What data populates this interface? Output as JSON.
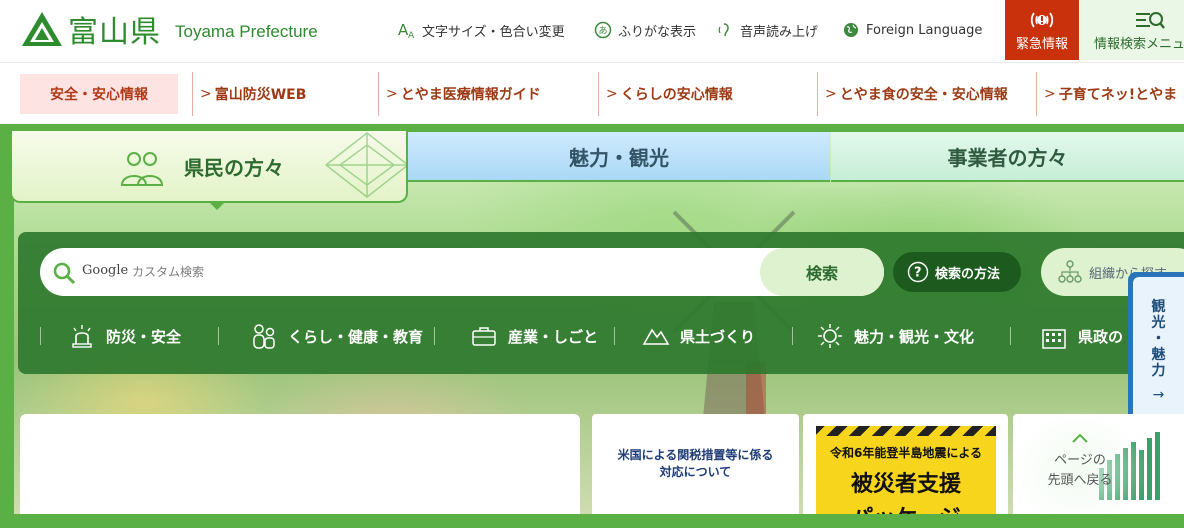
{
  "header": {
    "logo_jp": "富山県",
    "logo_en": "Toyama Prefecture",
    "utilities": [
      {
        "icon": "text-size-icon",
        "label": "文字サイズ・色合い変更"
      },
      {
        "icon": "furigana-icon",
        "label": "ふりがな表示"
      },
      {
        "icon": "audio-icon",
        "label": "音声読み上げ"
      },
      {
        "icon": "globe-icon",
        "label": "Foreign Language"
      }
    ],
    "emergency_label": "緊急情報",
    "search_menu_label": "情報検索メニュー"
  },
  "safety": {
    "title": "安全・安心情報",
    "links": [
      {
        "label": "富山防災WEB"
      },
      {
        "label": "とやま医療情報ガイド"
      },
      {
        "label": "くらしの安心情報"
      },
      {
        "label": "とやま食の安全・安心情報"
      },
      {
        "label": "子育てネッ!とやま"
      }
    ]
  },
  "tabs": [
    {
      "label": "県民の方々",
      "active": true
    },
    {
      "label": "魅力・観光",
      "active": false
    },
    {
      "label": "事業者の方々",
      "active": false
    }
  ],
  "search": {
    "brand": "Google",
    "placeholder": "カスタム検索",
    "button": "検索",
    "howto": "検索の方法",
    "org": "組織から探す"
  },
  "categories": [
    {
      "icon": "disaster-icon",
      "label": "防災・安全"
    },
    {
      "icon": "people-icon",
      "label": "くらし・健康・教育"
    },
    {
      "icon": "briefcase-icon",
      "label": "産業・しごと"
    },
    {
      "icon": "mountain-icon",
      "label": "県土づくり"
    },
    {
      "icon": "sun-icon",
      "label": "魅力・観光・文化"
    },
    {
      "icon": "building-icon",
      "label": "県政の"
    }
  ],
  "sidetab": {
    "chars": [
      "観",
      "光",
      "・",
      "魅",
      "力"
    ],
    "arrow": "→"
  },
  "banners": {
    "tariff": [
      "米国による関税措置等に係る",
      "対応について"
    ],
    "quake": {
      "line1": "令和6年能登半島地震による",
      "line2": "被災者支援",
      "line3": "パッケージ"
    }
  },
  "pagetop": {
    "line1": "ページの",
    "line2": "先頭へ戻る"
  },
  "colors": {
    "brand_green": "#2e8b2e",
    "hero_green": "#5ab045",
    "emergency_red": "#c8310c",
    "safety_pink": "#fde4e2"
  }
}
